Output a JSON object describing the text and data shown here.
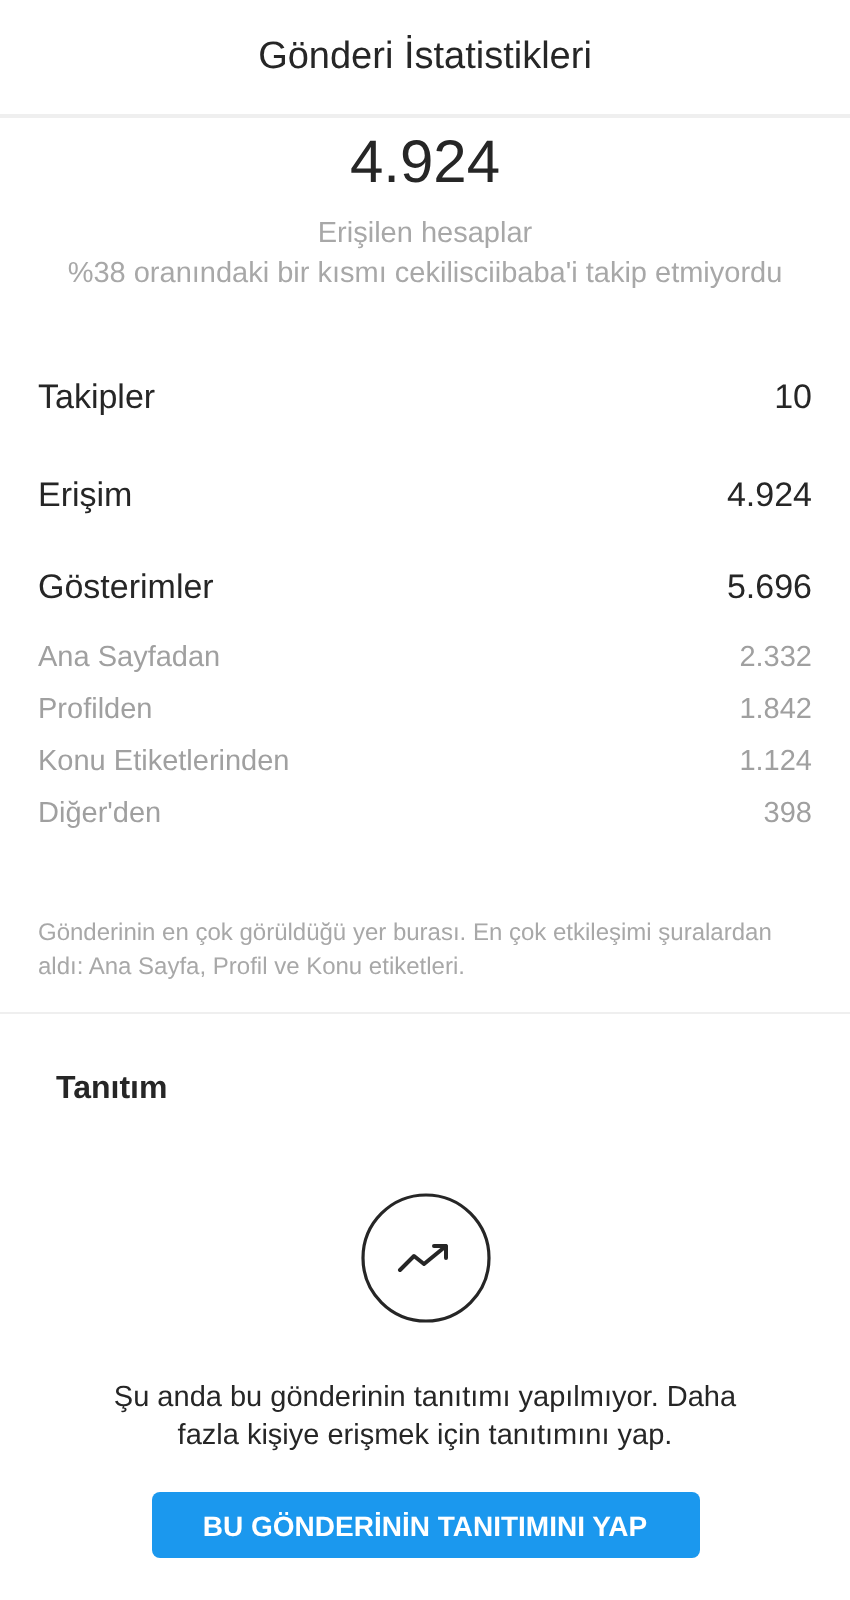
{
  "header": {
    "title": "Gönderi İstatistikleri"
  },
  "summary": {
    "value": "4.924",
    "label": "Erişilen hesaplar",
    "note": "%38 oranındaki bir kısmı cekilisciibaba'i takip etmiyordu"
  },
  "rows": [
    {
      "kind": "main",
      "label": "Takipler",
      "value": "10"
    },
    {
      "kind": "main",
      "label": "Erişim",
      "value": "4.924"
    },
    {
      "kind": "main",
      "label": "Gösterimler",
      "value": "5.696"
    },
    {
      "kind": "sub",
      "label": "Ana Sayfadan",
      "value": "2.332"
    },
    {
      "kind": "sub",
      "label": "Profilden",
      "value": "1.842"
    },
    {
      "kind": "sub",
      "label": "Konu Etiketlerinden",
      "value": "1.124"
    },
    {
      "kind": "sub",
      "label": "Diğer'den",
      "value": "398"
    }
  ],
  "footnote": "Gönderinin en çok görüldüğü yer burası. En çok etkileşimi şuralardan aldı: Ana Sayfa, Profil ve Konu etiketleri.",
  "promotion": {
    "title": "Tanıtım",
    "message": "Şu anda bu gönderinin tanıtımı yapılmıyor. Daha fazla kişiye erişmek için tanıtımını yap.",
    "button": "BU GÖNDERİNİN TANITIMINI YAP"
  }
}
